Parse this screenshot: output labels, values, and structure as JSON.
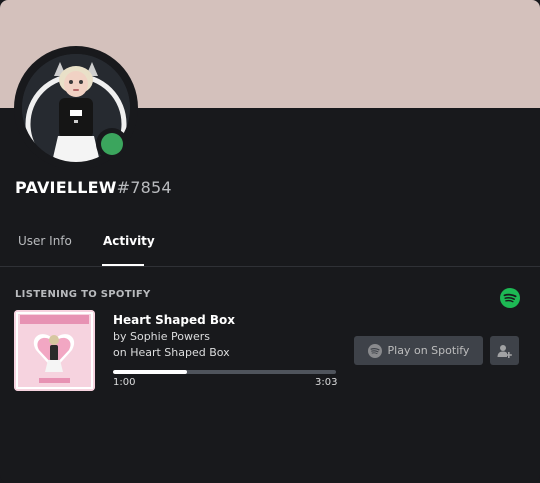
{
  "user": {
    "name": "PAVIELLEW",
    "discriminator": "#7854",
    "status": "online"
  },
  "tabs": [
    {
      "label": "User Info",
      "active": false
    },
    {
      "label": "Activity",
      "active": true
    }
  ],
  "activity": {
    "section_title": "LISTENING TO SPOTIFY",
    "track_title": "Heart Shaped Box",
    "artist_line": "by Sophie Powers",
    "album_line": "on Heart Shaped Box",
    "elapsed": "1:00",
    "duration": "3:03",
    "progress_fraction": 0.33,
    "play_button_label": "Play on Spotify",
    "album_art_text": "Sophie Powers"
  },
  "colors": {
    "banner": "#d4c1bc",
    "status_online": "#3ba55d",
    "spotify_green": "#1db954",
    "background": "#18191c"
  },
  "icons": [
    "spotify-icon",
    "add-friend-icon"
  ]
}
